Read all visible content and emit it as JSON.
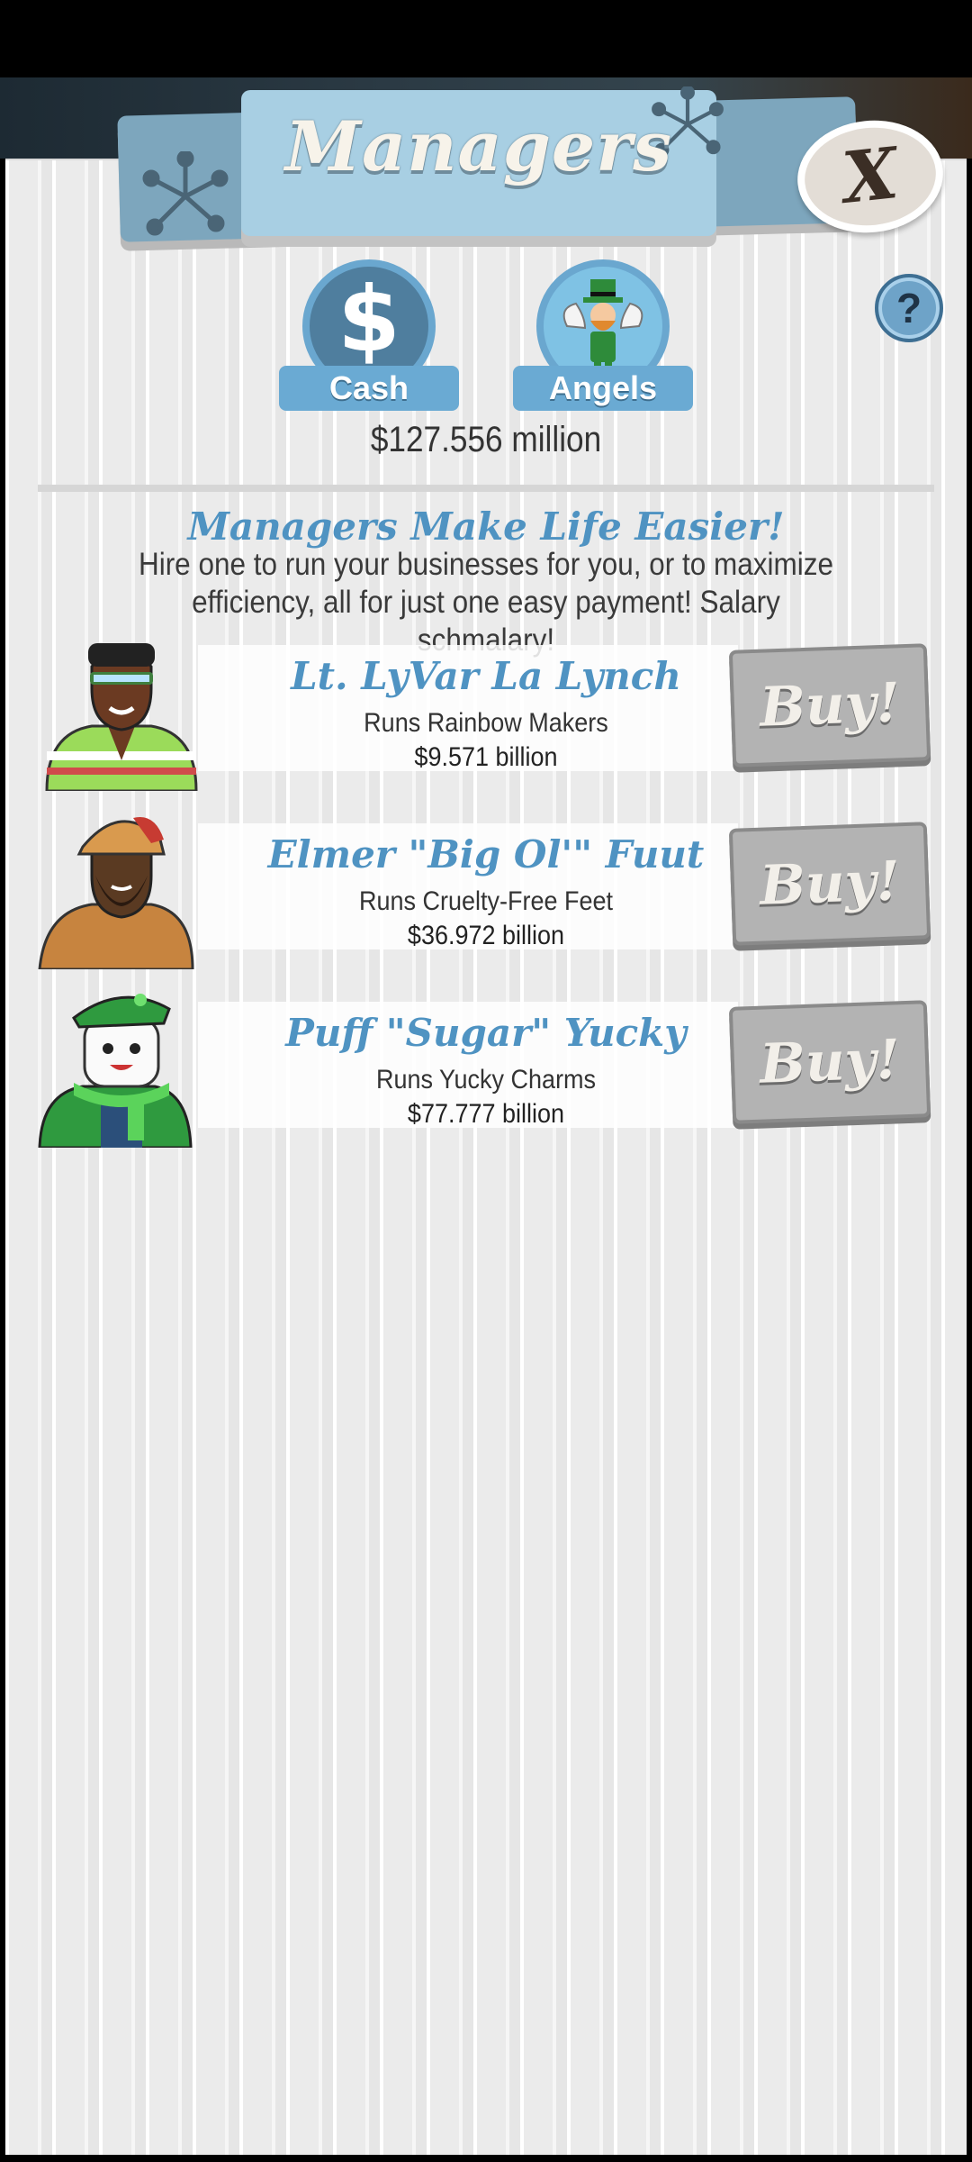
{
  "header": {
    "title": "Managers",
    "close_label": "X",
    "help_label": "?"
  },
  "tabs": [
    {
      "label": "Cash",
      "icon": "dollar-icon",
      "glyph": "$"
    },
    {
      "label": "Angels",
      "icon": "angel-leprechaun-icon"
    }
  ],
  "balance": "$127.556 million",
  "intro": {
    "headline": "Managers Make Life Easier!",
    "text": "Hire one to run your businesses for you, or to maximize efficiency, all for just one easy payment! Salary schmalary!"
  },
  "managers": [
    {
      "name": "Lt. LyVar La Lynch",
      "business": "Runs Rainbow Makers",
      "price": "$9.571 billion",
      "buy_label": "Buy!"
    },
    {
      "name": "Elmer \"Big Ol'\" Fuut",
      "business": "Runs Cruelty-Free Feet",
      "price": "$36.972 billion",
      "buy_label": "Buy!"
    },
    {
      "name": "Puff \"Sugar\" Yucky",
      "business": "Runs Yucky Charms",
      "price": "$77.777 billion",
      "buy_label": "Buy!"
    }
  ],
  "colors": {
    "accent_blue": "#4f93c2",
    "tab_blue": "#6aaad3",
    "buy_gray": "#b3b3b3"
  }
}
